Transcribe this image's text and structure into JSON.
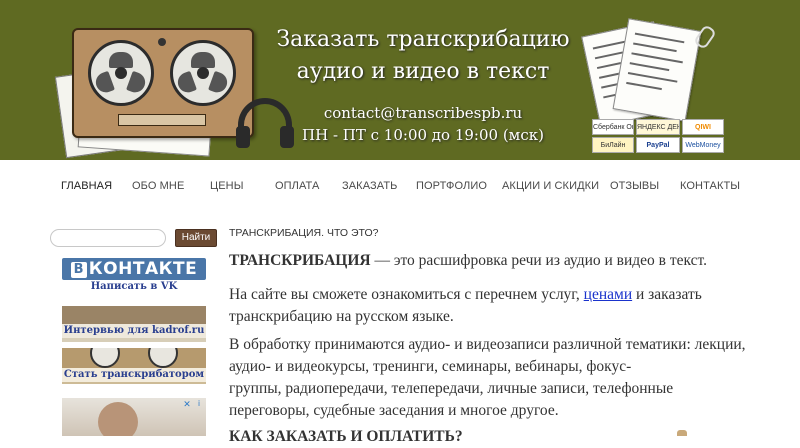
{
  "header": {
    "title_line1": "Заказать транскрибацию",
    "title_line2": "аудио и видео в текст",
    "email": "contact@transcribespb.ru",
    "hours": "ПН - ПТ с 10:00 до 19:00 (мск)",
    "background_color": "#5f6a22",
    "payments": {
      "sberbank": "Сбербанк Онлайн",
      "yandex": "ЯНДЕКС ДЕНЬГИ",
      "qiwi": "QIWI",
      "beeline": "БиЛайн",
      "paypal": "PayPal",
      "webmoney": "WebMoney"
    }
  },
  "nav": {
    "items": [
      {
        "label": "ГЛАВНАЯ"
      },
      {
        "label": "ОБО МНЕ"
      },
      {
        "label": "ЦЕНЫ"
      },
      {
        "label": "ОПЛАТА"
      },
      {
        "label": "ЗАКАЗАТЬ"
      },
      {
        "label": "ПОРТФОЛИО"
      },
      {
        "label": "АКЦИИ И СКИДКИ"
      },
      {
        "label": "ОТЗЫВЫ"
      },
      {
        "label": "КОНТАКТЫ"
      }
    ]
  },
  "sidebar": {
    "search": {
      "placeholder": "",
      "button_label": "Найти"
    },
    "vk": {
      "logo_b": "В",
      "logo_text": "КОНТАКТЕ",
      "caption": "Написать в VK",
      "color": "#4a76a8"
    },
    "kadrof": {
      "caption": "Интервью для kadrof.ru"
    },
    "transcriber": {
      "caption": "Стать транскрибатором"
    },
    "ad": {
      "choice": "i",
      "close": "✕"
    }
  },
  "main": {
    "heading": "ТРАНСКРИБАЦИЯ. ЧТО ЭТО?",
    "p1_bold": "ТРАНСКРИБАЦИЯ",
    "p1_rest": " — это расшифровка речи из аудио и видео в текст.",
    "p2_before": "На сайте вы сможете ознакомиться с перечнем услуг, ",
    "p2_link": "ценами",
    "p2_after": " и заказать транскрибацию на русском языке.",
    "p3_line1": "В обработку принимаются аудио- и видеозаписи различной тематики: лекции, аудио- и видеокурсы, тренинги, семинары, вебинары, фокус-",
    "p3_line2": "группы, радиопередачи, телепередачи, личные записи, телефонные переговоры, судебные заседания и многое другое.",
    "p4": "КАК ЗАКАЗАТЬ И ОПЛАТИТЬ?",
    "link_color": "#1a33cc"
  }
}
